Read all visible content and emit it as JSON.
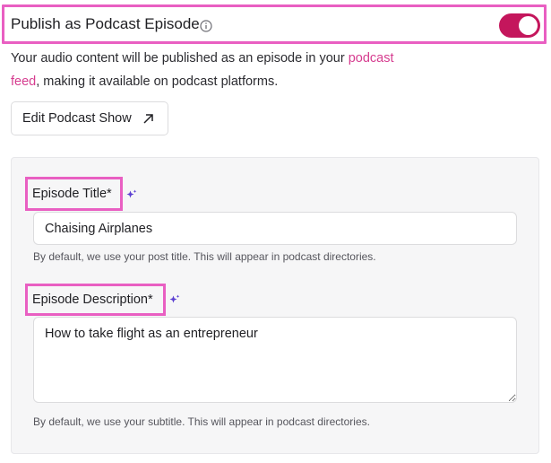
{
  "header": {
    "title": "Publish as Podcast Episode",
    "toggle_on": true,
    "accent_color": "#c4165c"
  },
  "description": {
    "part1": "Your audio content will be published as an episode in your ",
    "link": "podcast feed",
    "part2": ", making it available on podcast platforms."
  },
  "edit_button": {
    "label": "Edit Podcast Show",
    "icon": "arrow-up-right-icon"
  },
  "episode_title": {
    "label": "Episode Title*",
    "value": "Chaising Airplanes",
    "help": "By default, we use your post title. This will appear in podcast directories."
  },
  "episode_description": {
    "label": "Episode Description*",
    "value": "How to take flight as an entrepreneur",
    "help": "By default, we use your subtitle. This will appear in podcast directories."
  },
  "colors": {
    "highlight": "#e95fc2",
    "link": "#d63c8f",
    "sparkle": "#5b3fd1"
  }
}
